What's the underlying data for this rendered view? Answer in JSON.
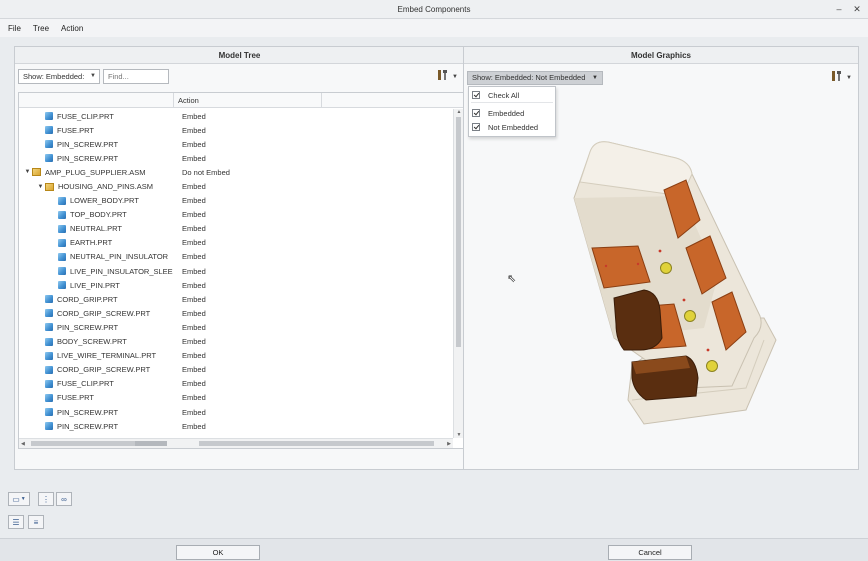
{
  "window": {
    "title": "Embed Components"
  },
  "menu": {
    "items": [
      "File",
      "Tree",
      "Action"
    ]
  },
  "model_tree": {
    "header": "Model Tree",
    "show_dropdown": "Show: Embedded:",
    "find_placeholder": "Find...",
    "column_action": "Action",
    "rows": [
      {
        "name": "FUSE_CLIP.PRT",
        "action": "Embed",
        "type": "part",
        "indent": 2,
        "expander": ""
      },
      {
        "name": "FUSE.PRT",
        "action": "Embed",
        "type": "part",
        "indent": 2,
        "expander": ""
      },
      {
        "name": "PIN_SCREW.PRT",
        "action": "Embed",
        "type": "part",
        "indent": 2,
        "expander": ""
      },
      {
        "name": "PIN_SCREW.PRT",
        "action": "Embed",
        "type": "part",
        "indent": 2,
        "expander": ""
      },
      {
        "name": "AMP_PLUG_SUPPLIER.ASM",
        "action": "Do not Embed",
        "type": "asm",
        "indent": 1,
        "expander": "▼"
      },
      {
        "name": "HOUSING_AND_PINS.ASM",
        "action": "Embed",
        "type": "asm",
        "indent": 2,
        "expander": "▼"
      },
      {
        "name": "LOWER_BODY.PRT",
        "action": "Embed",
        "type": "part",
        "indent": 3,
        "expander": ""
      },
      {
        "name": "TOP_BODY.PRT",
        "action": "Embed",
        "type": "part",
        "indent": 3,
        "expander": ""
      },
      {
        "name": "NEUTRAL.PRT",
        "action": "Embed",
        "type": "part",
        "indent": 3,
        "expander": ""
      },
      {
        "name": "EARTH.PRT",
        "action": "Embed",
        "type": "part",
        "indent": 3,
        "expander": ""
      },
      {
        "name": "NEUTRAL_PIN_INSULATOR",
        "action": "Embed",
        "type": "part",
        "indent": 3,
        "expander": ""
      },
      {
        "name": "LIVE_PIN_INSULATOR_SLEE",
        "action": "Embed",
        "type": "part",
        "indent": 3,
        "expander": ""
      },
      {
        "name": "LIVE_PIN.PRT",
        "action": "Embed",
        "type": "part",
        "indent": 3,
        "expander": ""
      },
      {
        "name": "CORD_GRIP.PRT",
        "action": "Embed",
        "type": "part",
        "indent": 2,
        "expander": ""
      },
      {
        "name": "CORD_GRIP_SCREW.PRT",
        "action": "Embed",
        "type": "part",
        "indent": 2,
        "expander": ""
      },
      {
        "name": "PIN_SCREW.PRT",
        "action": "Embed",
        "type": "part",
        "indent": 2,
        "expander": ""
      },
      {
        "name": "BODY_SCREW.PRT",
        "action": "Embed",
        "type": "part",
        "indent": 2,
        "expander": ""
      },
      {
        "name": "LIVE_WIRE_TERMINAL.PRT",
        "action": "Embed",
        "type": "part",
        "indent": 2,
        "expander": ""
      },
      {
        "name": "CORD_GRIP_SCREW.PRT",
        "action": "Embed",
        "type": "part",
        "indent": 2,
        "expander": ""
      },
      {
        "name": "FUSE_CLIP.PRT",
        "action": "Embed",
        "type": "part",
        "indent": 2,
        "expander": ""
      },
      {
        "name": "FUSE.PRT",
        "action": "Embed",
        "type": "part",
        "indent": 2,
        "expander": ""
      },
      {
        "name": "PIN_SCREW.PRT",
        "action": "Embed",
        "type": "part",
        "indent": 2,
        "expander": ""
      },
      {
        "name": "PIN_SCREW.PRT",
        "action": "Embed",
        "type": "part",
        "indent": 2,
        "expander": ""
      }
    ]
  },
  "model_graphics": {
    "header": "Model Graphics",
    "show_dropdown": "Show: Embedded: Not Embedded",
    "popup": {
      "check_all": "Check All",
      "embedded": "Embedded",
      "not_embedded": "Not Embedded"
    }
  },
  "footer": {
    "ok_label": "OK",
    "cancel_label": "Cancel"
  },
  "icons": {
    "part": "part-icon",
    "assembly": "assembly-icon",
    "settings": "settings-icon"
  },
  "colors": {
    "model_body": "#ece6da",
    "model_orange": "#c8662a",
    "model_brown": "#5a2e10",
    "pin_yellow": "#e0d23a"
  }
}
